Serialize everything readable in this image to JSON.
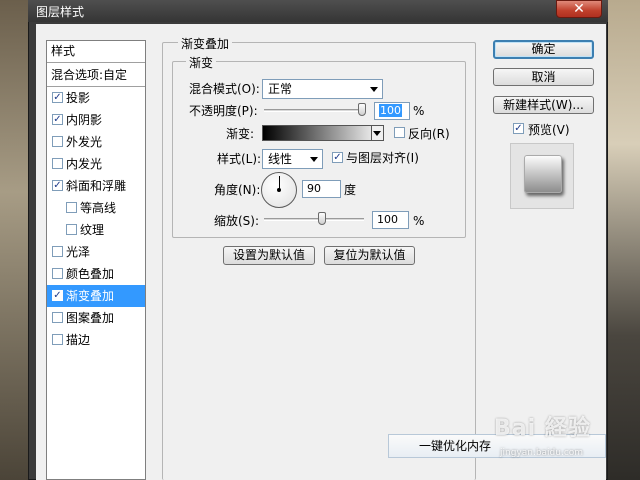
{
  "window": {
    "title": "图层样式",
    "close_glyph": "✕"
  },
  "style_list": {
    "header": "样式",
    "blend_options": "混合选项:自定",
    "items": [
      {
        "label": "投影",
        "checked": true,
        "sub": false,
        "selected": false
      },
      {
        "label": "内阴影",
        "checked": true,
        "sub": false,
        "selected": false
      },
      {
        "label": "外发光",
        "checked": false,
        "sub": false,
        "selected": false
      },
      {
        "label": "内发光",
        "checked": false,
        "sub": false,
        "selected": false
      },
      {
        "label": "斜面和浮雕",
        "checked": true,
        "sub": false,
        "selected": false
      },
      {
        "label": "等高线",
        "checked": false,
        "sub": true,
        "selected": false
      },
      {
        "label": "纹理",
        "checked": false,
        "sub": true,
        "selected": false
      },
      {
        "label": "光泽",
        "checked": false,
        "sub": false,
        "selected": false
      },
      {
        "label": "颜色叠加",
        "checked": false,
        "sub": false,
        "selected": false
      },
      {
        "label": "渐变叠加",
        "checked": true,
        "sub": false,
        "selected": true
      },
      {
        "label": "图案叠加",
        "checked": false,
        "sub": false,
        "selected": false
      },
      {
        "label": "描边",
        "checked": false,
        "sub": false,
        "selected": false
      }
    ]
  },
  "panel": {
    "outer_title": "渐变叠加",
    "inner_title": "渐变",
    "blend_mode_label": "混合模式(O):",
    "blend_mode_value": "正常",
    "opacity_label": "不透明度(P):",
    "opacity_value": "100",
    "opacity_level": 1.0,
    "percent": "%",
    "gradient_label": "渐变:",
    "reverse_label": "反向(R)",
    "reverse_checked": false,
    "style_label": "样式(L):",
    "style_value": "线性",
    "align_label": "与图层对齐(I)",
    "align_checked": true,
    "angle_label": "角度(N):",
    "angle_value": "90",
    "angle_unit": "度",
    "scale_label": "缩放(S):",
    "scale_value": "100",
    "scale_level": 0.5,
    "make_default": "设置为默认值",
    "reset_default": "复位为默认值"
  },
  "buttons": {
    "ok": "确定",
    "cancel": "取消",
    "new_style": "新建样式(W)...",
    "preview_label": "预览(V)",
    "preview_checked": true
  },
  "overlay": {
    "optimize_text": "一键优化内存",
    "watermark": "Bai 経验",
    "watermark_url": "jingyan.baidu.com"
  },
  "colors": {
    "selection": "#3399ff",
    "dialog_bg": "#f0f0f0",
    "close_red": "#c0402c"
  },
  "icons": {
    "check": "✓",
    "dropdown": "chevron-down-icon",
    "close": "close-icon"
  }
}
